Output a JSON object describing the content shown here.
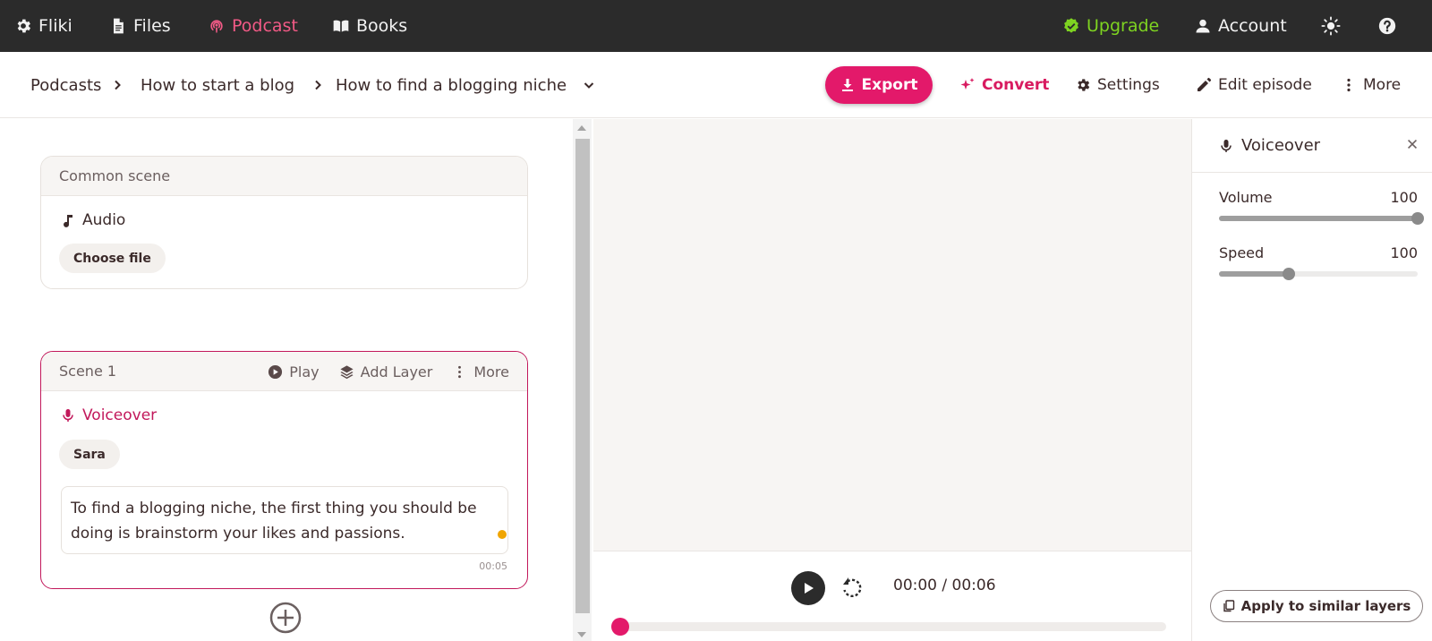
{
  "colors": {
    "nav_bg": "#2b2b2b",
    "brand_pink": "#e3196a",
    "upgrade_green": "#7ed321",
    "podcast_active": "#f25a86",
    "preview_bg": "#f7f5f3",
    "dot_orange": "#f0a500"
  },
  "topnav": {
    "logo_icon": "cog-icon",
    "brand": "Fliki",
    "files": "Files",
    "podcast": "Podcast",
    "books": "Books",
    "upgrade": "Upgrade",
    "account": "Account",
    "theme_icon": "sun-icon",
    "help_icon": "help-icon"
  },
  "breadcrumb": {
    "items": [
      "Podcasts",
      "How to start a blog",
      "How to find a blogging niche"
    ]
  },
  "toolbar": {
    "export": "Export",
    "convert": "Convert",
    "settings": "Settings",
    "edit_episode": "Edit episode",
    "more": "More"
  },
  "common_scene": {
    "title": "Common scene",
    "audio_label": "Audio",
    "choose_file": "Choose file"
  },
  "scene1": {
    "title": "Scene 1",
    "play": "Play",
    "add_layer": "Add Layer",
    "more": "More",
    "voiceover_label": "Voiceover",
    "voice_name": "Sara",
    "text": "To find a blogging niche, the first thing you should be doing is brainstorm your likes and passions.",
    "duration": "00:05"
  },
  "player": {
    "time": "00:00 / 00:06",
    "progress": 0
  },
  "voiceover_panel": {
    "title": "Voiceover",
    "volume_label": "Volume",
    "volume_value": "100",
    "volume_level": 1.0,
    "speed_label": "Speed",
    "speed_value": "100",
    "speed_level": 0.35,
    "apply_button": "Apply to similar layers"
  }
}
